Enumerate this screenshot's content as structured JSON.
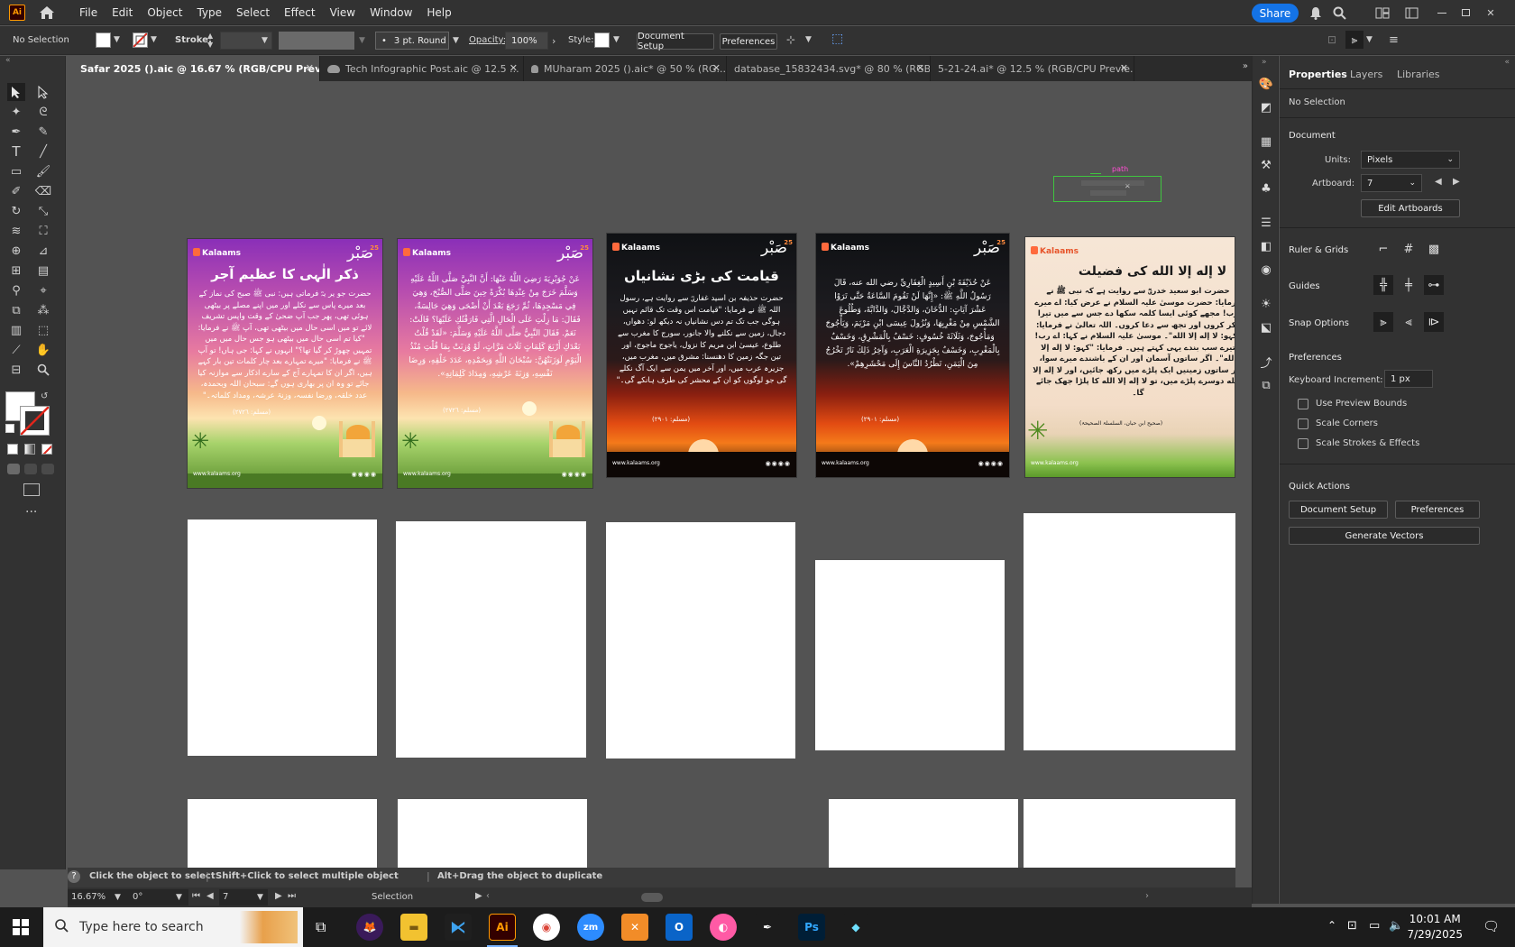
{
  "app": {
    "logo": "Ai",
    "home_icon": "home-icon"
  },
  "menu": [
    "File",
    "Edit",
    "Object",
    "Type",
    "Select",
    "Effect",
    "View",
    "Window",
    "Help"
  ],
  "share": "Share",
  "control_bar": {
    "selection": "No Selection",
    "stroke_label": "Stroke:",
    "stroke_profile": "3 pt. Round",
    "opacity_label": "Opacity:",
    "opacity_value": "100%",
    "style_label": "Style:",
    "document_setup": "Document Setup",
    "preferences": "Preferences"
  },
  "tabs": [
    {
      "label": "Safar 2025 ().aic @ 16.67 % (RGB/CPU Preview)",
      "active": true,
      "cloud": true
    },
    {
      "label": "Tech Infographic Post.aic @ 12.5 ...",
      "active": false,
      "cloud": true
    },
    {
      "label": "MUharam 2025 ().aic* @ 50 % (RG...",
      "active": false,
      "cloud": true
    },
    {
      "label": "database_15832434.svg* @ 80 % (RGB...",
      "active": false,
      "cloud": false
    },
    {
      "label": "5-21-24.ai* @ 12.5 % (RGB/CPU Previe...",
      "active": false,
      "cloud": false
    }
  ],
  "canvas": {
    "path_label": "path",
    "posters": [
      {
        "brand": "Kalaams",
        "logo": "صَبْر",
        "num": "25",
        "title": "ذکر الٰہی کا عظیم آجر",
        "body": "حضرت جو یر یہؓ فرماتی ہیں: نبی ﷺ صبح کی نماز کے بعد میرے پاس سے نکلے اور میں اپنے مصلے پر بیٹھی ہوئی تھی، پھر جب آپ ضحیٰ کے وقت واپس تشریف لائے تو میں اسی حال میں بیٹھی تھی، آپ ﷺ نے فرمایا: \"کیا تم اسی حال میں بیٹھی ہو جس حال میں میں تمہیں چھوڑ کر گیا تھا؟\" انہوں نے کہا: جی ہاں! تو آپ ﷺ نے فرمایا: \"میرے تمہارے بعد چار کلمات تین بار کہے ہیں، اگر ان کا تمہارے آج کے سارے اذکار سے موازنہ کیا جائے تو وہ ان پر بھاری ہوں گے: سبحان اللہ وبحمدہ، عدد خلقہ، ورضا نفسہ، وزنۃ عرشہ، ومداد کلماتہ۔\"",
        "ref": "(مسلم: ٢٧٢٦)",
        "url": "www.kalaams.org",
        "socials": "◉◉◉◉"
      },
      {
        "brand": "Kalaams",
        "logo": "صَبْر",
        "num": "25",
        "title": "",
        "body": "عَنْ جُوَيْرِيَةَ رَضِيَ اللَّهُ عَنْهَا: أَنَّ النَّبِيَّ صَلَّى اللَّهُ عَلَيْهِ وَسَلَّمَ خَرَجَ مِنْ عِنْدِهَا بُكْرَةً حِينَ صَلَّى الصُّبْحَ، وَهِيَ فِي مَسْجِدِهَا، ثُمَّ رَجَعَ بَعْدَ أَنْ أَضْحَى وَهِيَ جَالِسَةٌ، فَقَالَ: مَا زِلْتِ عَلَى الْحَالِ الَّتِي فَارَقْتُكِ عَلَيْهَا؟ قَالَتْ: نَعَمْ. فَقَالَ النَّبِيُّ صَلَّى اللَّهُ عَلَيْهِ وَسَلَّمَ: «لَقَدْ قُلْتُ بَعْدَكِ أَرْبَعَ كَلِمَاتٍ ثَلَاثَ مَرَّاتٍ، لَوْ وُزِنَتْ بِمَا قُلْتِ مُنْذُ الْيَوْمِ لَوَزَنَتْهُنَّ: سُبْحَانَ اللَّهِ وَبِحَمْدِهِ، عَدَدَ خَلْقِهِ، وَرِضَا نَفْسِهِ، وَزِنَةَ عَرْشِهِ، وَمِدَادَ كَلِمَاتِهِ».",
        "ref": "(مسلم: ٢٧٢٦)",
        "url": "www.kalaams.org",
        "socials": "◉◉◉◉"
      },
      {
        "brand": "Kalaams",
        "logo": "صَبْر",
        "num": "25",
        "title": "قیامت کی بڑی نشانیاں",
        "body": "حضرت حذیفہ بن اسید غفاریؓ سے روایت ہے، رسول اللہ ﷺ نے فرمایا: \"قیامت اس وقت تک قائم نہیں ہوگی جب تک تم دس نشانیاں نہ دیکھ لو: دھواں، دجال، زمین سے نکلنے والا جانور، سورج کا مغرب سے طلوع، عیسیٰ ابن مریم کا نزول، یاجوج ماجوج، اور تین جگہ زمین کا دھنسنا: مشرق میں، مغرب میں، جزیرہ عرب میں، اور آخر میں یمن سے ایک آگ نکلے گی جو لوگوں کو ان کے محشر کی طرف ہانکے گی۔\"",
        "ref": "(مسلم: ٢٩٠١)",
        "url": "www.kalaams.org",
        "socials": "◉◉◉◉"
      },
      {
        "brand": "Kalaams",
        "logo": "صَبْر",
        "num": "25",
        "title": "",
        "body": "عَنْ حُذَيْفَةَ بْنِ أَسِيدٍ الْغِفَارِيِّ رضي الله عنه، قَالَ رَسُولُ اللَّهِ ﷺ: «إِنَّهَا لَنْ تَقُومَ السَّاعَةُ حَتَّى تَرَوْا عَشْرَ آيَاتٍ: الدُّخَانَ، وَالدَّجَّالَ، وَالدَّابَّةَ، وَطُلُوعَ الشَّمْسِ مِنْ مَغْرِبِهَا، وَنُزُولَ عِيسَى ابْنِ مَرْيَمَ، وَيَأْجُوجَ وَمَأْجُوجَ، وَثَلَاثَةَ خُسُوفٍ: خَسْفٌ بِالْمَشْرِقِ، وَخَسْفٌ بِالْمَغْرِبِ، وَخَسْفٌ بِجَزِيرَةِ الْعَرَبِ، وَآخِرُ ذَلِكَ نَارٌ تَخْرُجُ مِنَ الْيَمَنِ، تَطْرُدُ النَّاسَ إِلَى مَحْشَرِهِمْ».",
        "ref": "(مسلم: ٢٩٠١)",
        "url": "www.kalaams.org",
        "socials": "◉◉◉◉"
      },
      {
        "brand": "Kalaams",
        "logo": "",
        "num": "",
        "title": "لا إله إلا الله کی فضیلت",
        "body": "حضرت ابو سعید خدریؓ سے روایت ہے کہ نبی ﷺ نے فرمایا: حضرت موسیٰ علیہ السلام نے عرض کیا: اے میرے رب! مجھے کوئی ایسا کلمہ سکھا دے جس سے میں تیرا ذکر کروں اور تجھ سے دعا کروں۔ اللہ تعالیٰ نے فرمایا: \"کہو: لا إله إلا الله\"۔ موسیٰ علیہ السلام نے کہا: اے رب! تیرے سب بندے یہی کہتے ہیں۔ فرمایا: \"کہو: لا إله إلا الله\"۔ اگر ساتوں آسمان اور ان کے باشندے میرے سوا، اور ساتوں زمینیں ایک پلڑے میں رکھ جائیں، اور لا إله إلا الله دوسرے پلڑے میں، تو لا إله إلا الله کا پلڑا جھک جائے گا۔",
        "ref": "(صحیح ابن حبان، السلسلۃ الصحیحۃ)",
        "url": "www.kalaams.org",
        "socials": ""
      }
    ]
  },
  "status_hint": {
    "a": "Click the object to select",
    "b": "Shift+Click to select multiple object",
    "c": "Alt+Drag the object to duplicate"
  },
  "zoom_bar": {
    "zoom": "16.67%",
    "rotation": "0°",
    "artboard": "7",
    "tool": "Selection"
  },
  "panel": {
    "tabs": [
      "Properties",
      "Layers",
      "Libraries"
    ],
    "selection": "No Selection",
    "document_head": "Document",
    "units_label": "Units:",
    "units_value": "Pixels",
    "artboard_label": "Artboard:",
    "artboard_value": "7",
    "edit_artboards": "Edit Artboards",
    "ruler_grids": "Ruler & Grids",
    "guides": "Guides",
    "snap_options": "Snap Options",
    "preferences_head": "Preferences",
    "keyboard_increment_label": "Keyboard Increment:",
    "keyboard_increment_value": "1 px",
    "checks": [
      "Use Preview Bounds",
      "Scale Corners",
      "Scale Strokes & Effects"
    ],
    "quick_actions": "Quick Actions",
    "document_setup": "Document Setup",
    "preferences": "Preferences",
    "generate_vectors": "Generate Vectors"
  },
  "taskbar": {
    "search_placeholder": "Type here to search",
    "time": "10:01 AM",
    "date": "7/29/2025"
  },
  "colors": {
    "accent": "#1473e6",
    "ai_orange": "#ff9a00",
    "panel_bg": "#323232",
    "canvas_bg": "#535353"
  }
}
